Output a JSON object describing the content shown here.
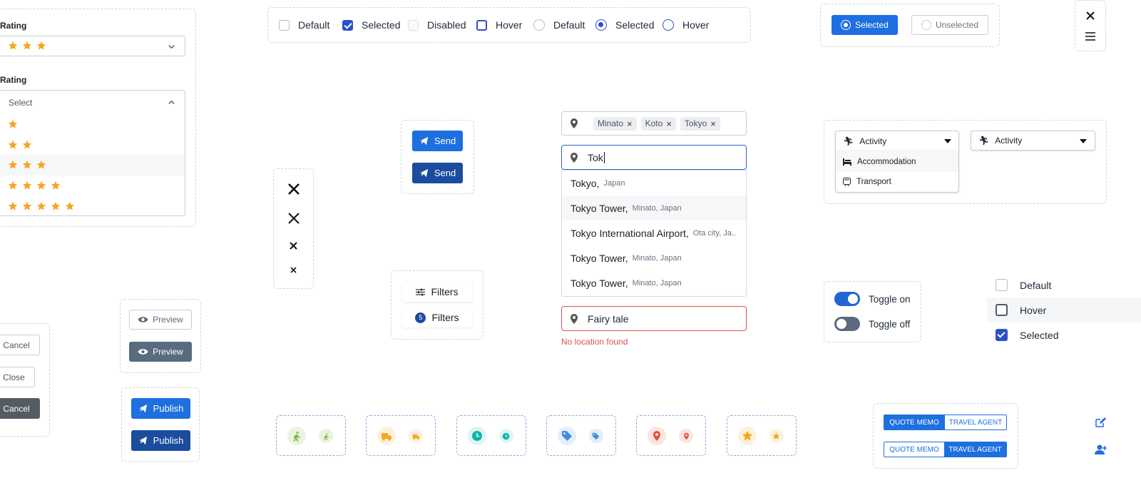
{
  "rating": {
    "label1": "Rating",
    "label2": "Rating",
    "select_placeholder": "Select",
    "selected_stars": 3,
    "options": [
      1,
      2,
      3,
      4,
      5
    ]
  },
  "checks": {
    "cb_default": "Default",
    "cb_selected": "Selected",
    "cb_disabled": "Disabled",
    "cb_hover": "Hover",
    "rd_default": "Default",
    "rd_selected": "Selected",
    "rd_hover": "Hover"
  },
  "radio_buttons": {
    "selected": "Selected",
    "unselected": "Unselected"
  },
  "send": {
    "label1": "Send",
    "label2": "Send"
  },
  "location": {
    "chips": [
      "Minato",
      "Koto",
      "Tokyo"
    ],
    "search_value": "Tok",
    "results": [
      {
        "main": "Tokyo,",
        "sub": "Japan"
      },
      {
        "main": "Tokyo Tower,",
        "sub": "Minato, Japan"
      },
      {
        "main": "Tokyo International Airport,",
        "sub": "Ota city, Ja.."
      },
      {
        "main": "Tokyo Tower,",
        "sub": "Minato, Japan"
      },
      {
        "main": "Tokyo Tower,",
        "sub": "Minato, Japan"
      }
    ],
    "error_value": "Fairy tale",
    "error_message": "No location found"
  },
  "activity": {
    "open_label": "Activity",
    "options": [
      "Accommodation",
      "Transport"
    ],
    "closed_label": "Activity"
  },
  "filters": {
    "label1": "Filters",
    "label2": "Filters",
    "count": "5"
  },
  "buttons": {
    "preview1": "Preview",
    "preview2": "Preview",
    "publish1": "Publish",
    "publish2": "Publish",
    "cancel1": "Cancel",
    "close": "Close",
    "cancel2": "Cancel"
  },
  "toggles": {
    "on": "Toggle on",
    "off": "Toggle off"
  },
  "list_checks": {
    "default": "Default",
    "hover": "Hover",
    "selected": "Selected"
  },
  "segments": {
    "left": "QUOTE MEMO",
    "right": "TRAVEL AGENT"
  },
  "colors": {
    "primary": "#1e6fe0",
    "navy": "#1b4c9e",
    "star": "#f5a623",
    "error": "#d9534f",
    "green": "#7cb342",
    "orange": "#f5a623",
    "teal": "#12b5a8",
    "blue": "#3b8fe0",
    "red": "#e5533d"
  },
  "icon_badges": [
    "activity-icon",
    "transport-icon",
    "clock-icon",
    "tag-icon",
    "location-pin-icon",
    "star-icon"
  ]
}
